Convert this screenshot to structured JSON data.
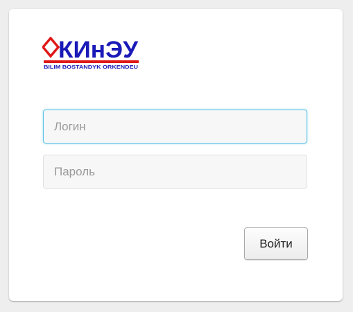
{
  "logo": {
    "title": "КИнЭУ",
    "tagline": "BILIM BOSTANDYK ORKENDEU",
    "icon": "red-diamond-icon",
    "colors": {
      "title": "#1a1ab8",
      "diamond": "#e01818",
      "bar": "#e01818",
      "tagline": "#1a1ab8"
    }
  },
  "form": {
    "login_placeholder": "Логин",
    "password_placeholder": "Пароль",
    "submit_label": "Войти"
  },
  "colors": {
    "focus_border": "#5cc3e6",
    "background": "#eeeeee",
    "card": "#ffffff"
  }
}
